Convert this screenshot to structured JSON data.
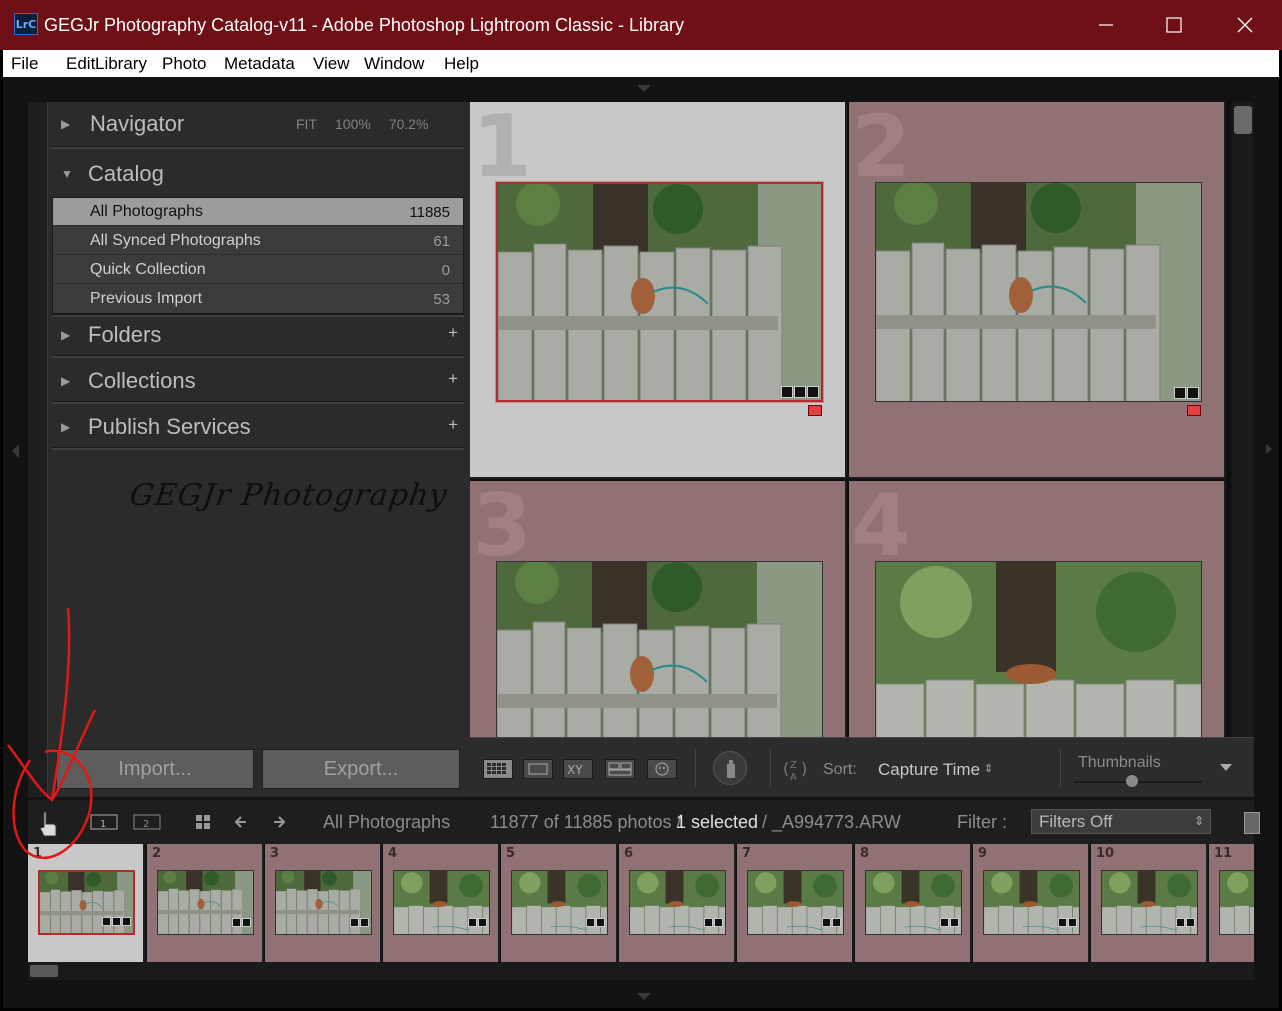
{
  "window": {
    "app_badge": "LrC",
    "title": "GEGJr Photography Catalog-v11 - Adobe Photoshop Lightroom Classic - Library"
  },
  "menu": [
    "File",
    "Edit",
    "Library",
    "Photo",
    "Metadata",
    "View",
    "Window",
    "Help"
  ],
  "left_panel": {
    "navigator": {
      "title": "Navigator",
      "options": [
        "FIT",
        "100%",
        "70.2%"
      ]
    },
    "catalog": {
      "title": "Catalog",
      "items": [
        {
          "label": "All Photographs",
          "count": "11885"
        },
        {
          "label": "All Synced Photographs",
          "count": "61"
        },
        {
          "label": "Quick Collection",
          "count": "0"
        },
        {
          "label": "Previous Import",
          "count": "53"
        }
      ]
    },
    "folders": {
      "title": "Folders"
    },
    "collections": {
      "title": "Collections"
    },
    "publish": {
      "title": "Publish Services"
    },
    "identity_plate": "GEGJr Photography",
    "import_label": "Import...",
    "export_label": "Export..."
  },
  "grid": {
    "cells": [
      {
        "num": "1"
      },
      {
        "num": "2"
      },
      {
        "num": "3"
      },
      {
        "num": "4"
      }
    ]
  },
  "toolbar": {
    "sort_label": "Sort:",
    "sort_value": "Capture Time",
    "thumbnails_label": "Thumbnails",
    "thumbnail_size": 0.45
  },
  "filmstrip_header": {
    "monitor1": "1",
    "monitor2": "2",
    "source": "All Photographs",
    "count_text": "11877 of 11885 photos /",
    "selected_text": "1 selected",
    "file_text": "/ _A994773.ARW",
    "filter_label": "Filter :",
    "filter_value": "Filters Off"
  },
  "filmstrip": {
    "numbers": [
      "1",
      "2",
      "3",
      "4",
      "5",
      "6",
      "7",
      "8",
      "9",
      "10",
      "11"
    ]
  },
  "colors": {
    "title_bar": "#6f1016",
    "cell_bg": "#907274",
    "selected_cell": "#c8c8c8",
    "annotation": "#e01818"
  }
}
